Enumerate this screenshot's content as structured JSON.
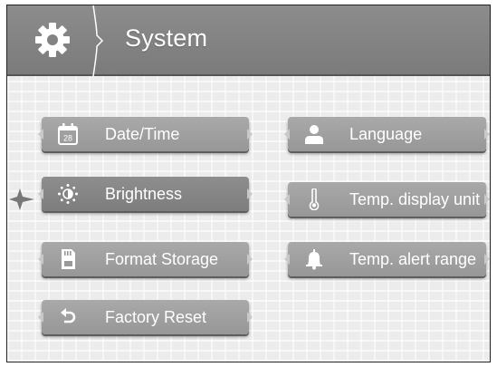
{
  "header": {
    "title": "System",
    "icon": "gear-icon"
  },
  "menu": {
    "left": [
      {
        "label": "Date/Time",
        "icon": "calendar-icon",
        "selected": false
      },
      {
        "label": "Brightness",
        "icon": "brightness-icon",
        "selected": true
      },
      {
        "label": "Format Storage",
        "icon": "sd-card-icon",
        "selected": false
      },
      {
        "label": "Factory Reset",
        "icon": "reset-arrow-icon",
        "selected": false
      }
    ],
    "right": [
      {
        "label": "Language",
        "icon": "user-icon",
        "selected": false
      },
      {
        "label": "Temp. display unit",
        "icon": "thermometer-icon",
        "selected": false
      },
      {
        "label": "Temp. alert range",
        "icon": "bell-icon",
        "selected": false
      }
    ]
  },
  "calendar_day": "28",
  "colors": {
    "header": "#838383",
    "button": "#a0a0a0",
    "button_selected": "#858585",
    "text": "#ffffff"
  }
}
